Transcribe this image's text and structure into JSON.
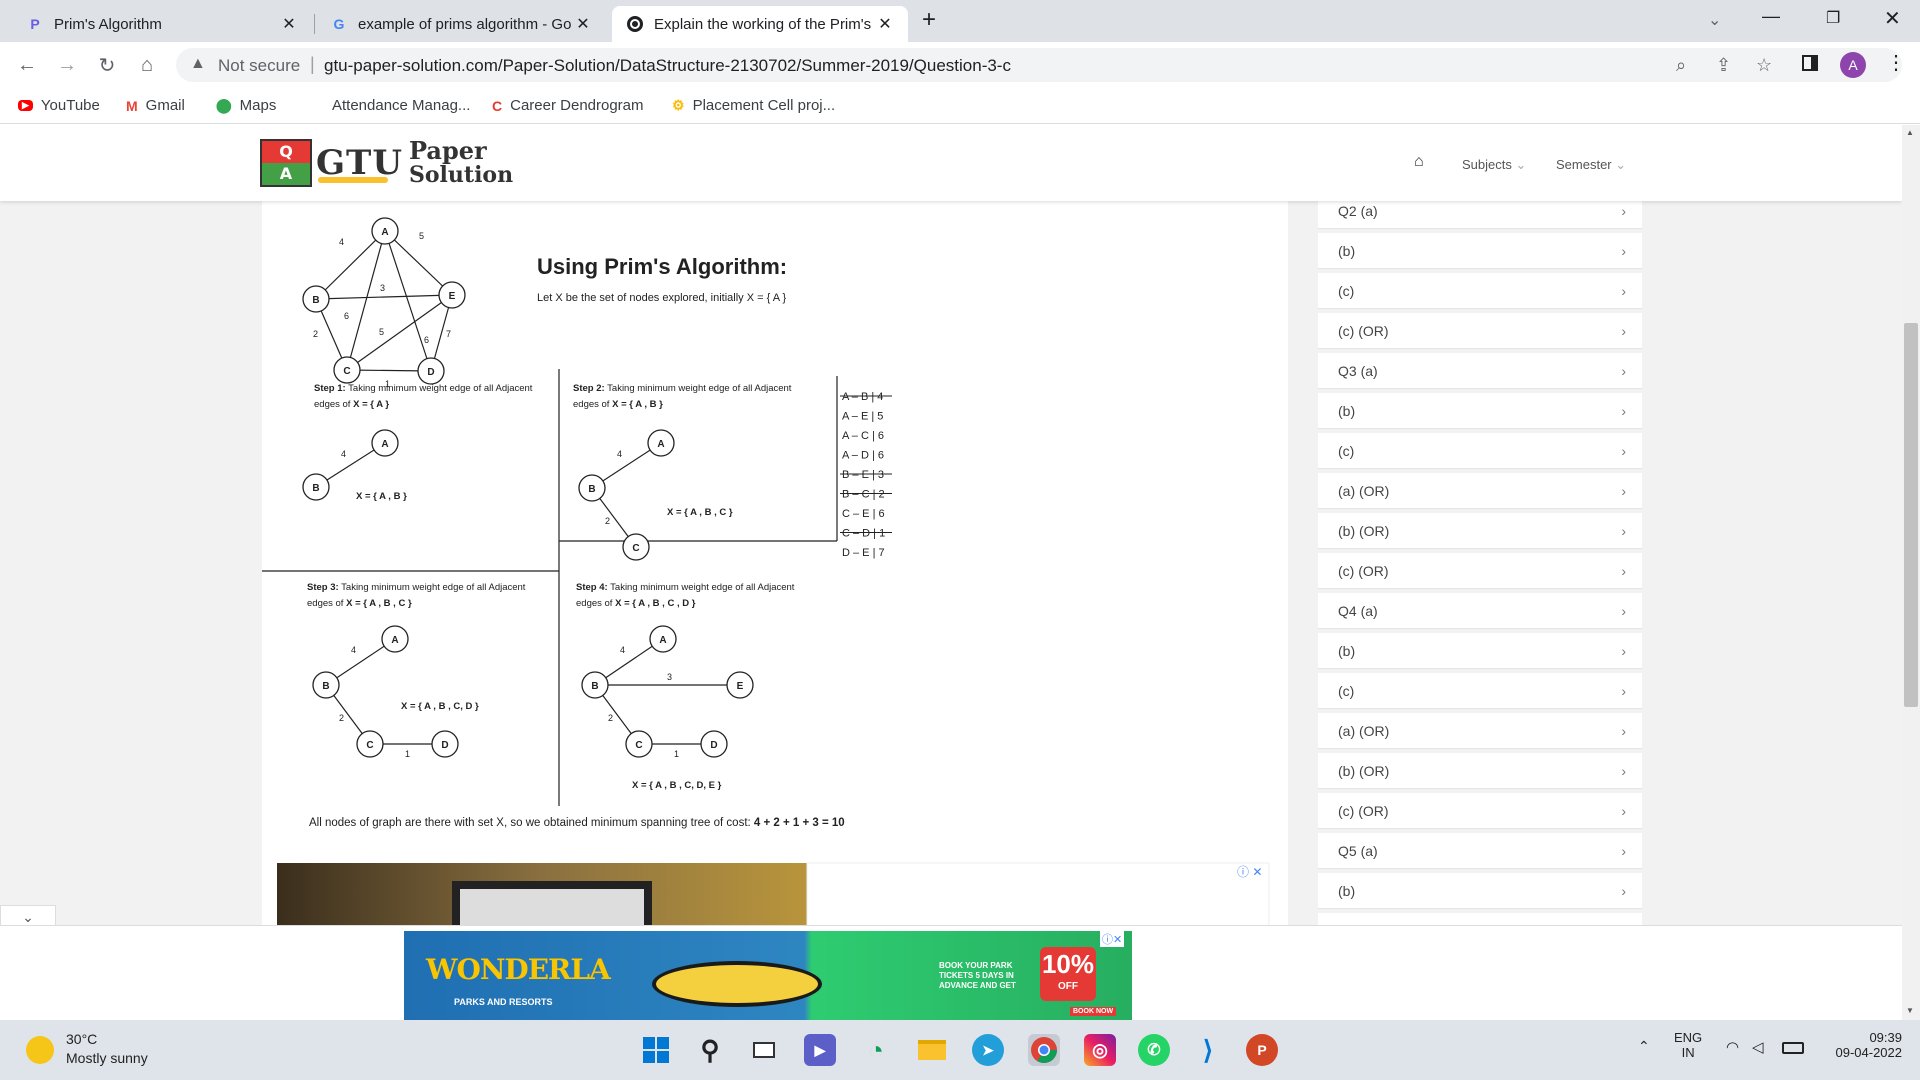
{
  "tabs": [
    {
      "title": "Prim's Algorithm",
      "favicon": "P"
    },
    {
      "title": "example of prims algorithm - Go",
      "favicon": "G"
    },
    {
      "title": "Explain the working of the Prim's",
      "favicon": "globe"
    }
  ],
  "toolbar": {
    "not_secure": "Not secure",
    "url": "gtu-paper-solution.com/Paper-Solution/DataStructure-2130702/Summer-2019/Question-3-c",
    "profile": "A"
  },
  "bookmarks": [
    "YouTube",
    "Gmail",
    "Maps",
    "Attendance Manag...",
    "Career Dendrogram",
    "Placement Cell proj..."
  ],
  "site": {
    "logo_gtu": "GTU",
    "logo_paper": "Paper",
    "logo_solution": "Solution",
    "logo_q": "Q",
    "logo_a": "A",
    "nav_subjects": "Subjects",
    "nav_semester": "Semester"
  },
  "solution": {
    "heading": "Using Prim's Algorithm:",
    "intro": "Let X be the set of nodes explored, initially X = { A }",
    "step1_bold": "Step 1:",
    "step1_text": " Taking minimum weight edge of all Adjacent",
    "step1_text2": "edges of ",
    "step1_set": "X = { A }",
    "step2_bold": "Step 2:",
    "step2_text": " Taking minimum weight edge of all Adjacent",
    "step2_text2": "edges of ",
    "step2_set": "X = { A , B }",
    "step3_bold": "Step 3:",
    "step3_text": " Taking minimum weight edge of all Adjacent",
    "step3_text2": "edges of ",
    "step3_set": "X = { A , B , C }",
    "step4_bold": "Step 4:",
    "step4_text": " Taking minimum weight edge of all Adjacent",
    "step4_text2": "edges of ",
    "step4_set": "X = { A , B , C , D }",
    "x1": "X = { A , B }",
    "x2": "X = { A , B , C }",
    "x3": "X = { A , B , C, D }",
    "x4": "X = { A , B , C, D, E }",
    "edge_list": [
      {
        "t": "A – B | 4",
        "struck": true
      },
      {
        "t": "A – E | 5",
        "struck": false
      },
      {
        "t": "A – C | 6",
        "struck": false
      },
      {
        "t": "A – D | 6",
        "struck": false
      },
      {
        "t": "B – E | 3",
        "struck": true
      },
      {
        "t": "B – C | 2",
        "struck": true
      },
      {
        "t": "C – E | 6",
        "struck": false
      },
      {
        "t": "C – D | 1",
        "struck": true
      },
      {
        "t": "D – E | 7",
        "struck": false
      }
    ],
    "conclusion_text": "All nodes of graph are there with set X, so we obtained minimum spanning tree of cost: ",
    "conclusion_bold": "4 + 2 + 1 + 3 = 10"
  },
  "graph_labels": {
    "A": "A",
    "B": "B",
    "C": "C",
    "D": "D",
    "E": "E",
    "w4": "4",
    "w5": "5",
    "w3": "3",
    "w6": "6",
    "w2": "2",
    "w1": "1",
    "w7": "7"
  },
  "sidebar": [
    "Q2 (a)",
    "(b)",
    "(c)",
    "(c) (OR)",
    "Q3 (a)",
    "(b)",
    "(c)",
    "(a) (OR)",
    "(b) (OR)",
    "(c) (OR)",
    "Q4 (a)",
    "(b)",
    "(c)",
    "(a) (OR)",
    "(b) (OR)",
    "(c) (OR)",
    "Q5 (a)",
    "(b)",
    "",
    ""
  ],
  "ad": {
    "brand": "WONDERLA",
    "sub": "PARKS AND RESORTS",
    "offer": "BOOK YOUR PARK TICKETS 5 DAYS IN ADVANCE AND GET",
    "pct": "10%",
    "off": "OFF",
    "cta": "BOOK NOW"
  },
  "taskbar": {
    "temp": "30°C",
    "weather": "Mostly sunny",
    "lang1": "ENG",
    "lang2": "IN",
    "time": "09:39",
    "date": "09-04-2022"
  }
}
